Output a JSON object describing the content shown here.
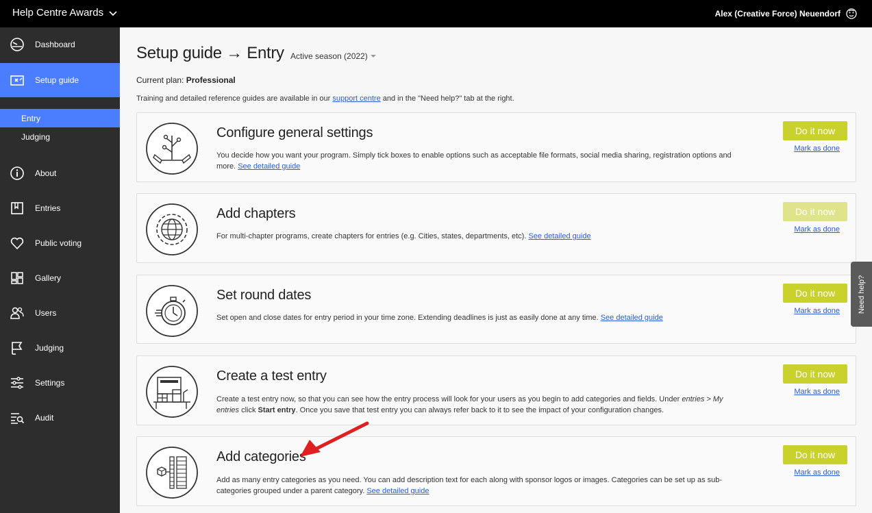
{
  "header": {
    "app_title": "Help Centre Awards",
    "user_name": "Alex (Creative Force) Neuendorf"
  },
  "sidebar": {
    "items": [
      {
        "label": "Dashboard",
        "icon": "dashboard-icon"
      },
      {
        "label": "Setup guide",
        "icon": "setup-guide-icon"
      },
      {
        "label": "About",
        "icon": "info-icon"
      },
      {
        "label": "Entries",
        "icon": "entries-icon"
      },
      {
        "label": "Public voting",
        "icon": "heart-icon"
      },
      {
        "label": "Gallery",
        "icon": "gallery-icon"
      },
      {
        "label": "Users",
        "icon": "users-icon"
      },
      {
        "label": "Judging",
        "icon": "judging-icon"
      },
      {
        "label": "Settings",
        "icon": "settings-icon"
      },
      {
        "label": "Audit",
        "icon": "audit-icon"
      }
    ],
    "sub_items": [
      {
        "label": "Entry"
      },
      {
        "label": "Judging"
      }
    ]
  },
  "main": {
    "title": "Setup guide → Entry",
    "season": "Active season (2022)",
    "plan_label": "Current plan:",
    "plan_value": "Professional",
    "training_pre": "Training and detailed reference guides are available in our ",
    "training_link": "support centre",
    "training_post": " and in the \"Need help?\" tab at the right.",
    "cards": [
      {
        "title": "Configure general settings",
        "desc": "You decide how you want your program. Simply tick boxes to enable options such as acceptable file formats, social media sharing, registration options and more. ",
        "guide": "See detailed guide",
        "action": "Do it now",
        "mark": "Mark as done"
      },
      {
        "title": "Add chapters",
        "desc": "For multi-chapter programs, create chapters for entries (e.g. Cities, states, departments, etc). ",
        "guide": "See detailed guide",
        "action": "Do it now",
        "mark": "Mark as done"
      },
      {
        "title": "Set round dates",
        "desc": "Set open and close dates for entry period in your time zone. Extending deadlines is just as easily done at any time. ",
        "guide": "See detailed guide",
        "action": "Do it now",
        "mark": "Mark as done"
      },
      {
        "title": "Create a test entry",
        "desc_a": "Create a test entry now, so that you can see how the entry process will look for your users as you begin to add categories and fields. Under ",
        "desc_em": "entries > My entries",
        "desc_b": " click ",
        "desc_strong": "Start entry",
        "desc_c": ". Once you save that test entry you can always refer back to it to see the impact of your configuration changes.",
        "action": "Do it now",
        "mark": "Mark as done"
      },
      {
        "title": "Add categories",
        "desc": "Add as many entry categories as you need. You can add description text for each along with sponsor logos or images. Categories can be set up as sub-categories grouped under a parent category. ",
        "guide": "See detailed guide",
        "action": "Do it now",
        "mark": "Mark as done"
      }
    ]
  },
  "help_tab": {
    "label": "Need help?"
  },
  "colors": {
    "accent": "#4a7dff",
    "action": "#c9d22d",
    "annotation_arrow": "#e02020"
  }
}
